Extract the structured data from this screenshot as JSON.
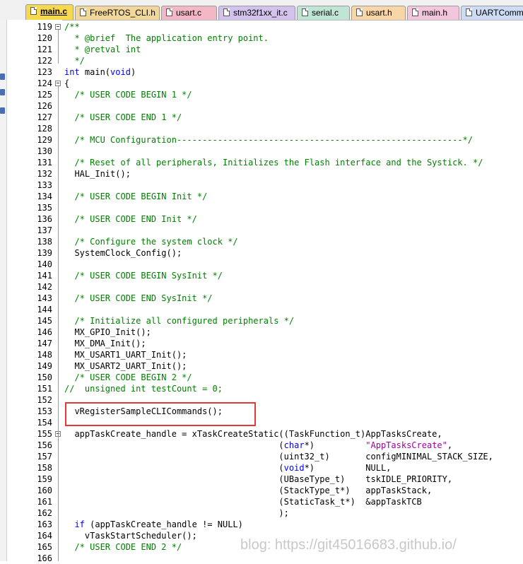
{
  "tabs": [
    {
      "label": "main.c",
      "active": true,
      "color": "#f7d94f"
    },
    {
      "label": "FreeRTOS_CLI.h",
      "active": false,
      "color": "#f2d79a"
    },
    {
      "label": "usart.c",
      "active": false,
      "color": "#f4b7c6"
    },
    {
      "label": "stm32f1xx_it.c",
      "active": false,
      "color": "#d3c2ec"
    },
    {
      "label": "serial.c",
      "active": false,
      "color": "#bfe6d5"
    },
    {
      "label": "usart.h",
      "active": false,
      "color": "#f8d6a8"
    },
    {
      "label": "main.h",
      "active": false,
      "color": "#f2c6dd"
    },
    {
      "label": "UARTComm",
      "active": false,
      "color": "#cddcf4"
    }
  ],
  "colors": {
    "comment": "#008000",
    "keyword": "#0000ff",
    "string": "#a000a0",
    "highlight_box": "#e53935"
  },
  "watermark": "blog: https://git45016683.github.io/",
  "lines": [
    {
      "n": "119",
      "fold": true,
      "parts": [
        [
          "cmt",
          "/**"
        ]
      ]
    },
    {
      "n": "120",
      "parts": [
        [
          "cmt",
          "  * @brief  The application entry point."
        ]
      ]
    },
    {
      "n": "121",
      "parts": [
        [
          "cmt",
          "  * @retval int"
        ]
      ]
    },
    {
      "n": "122",
      "parts": [
        [
          "cmt",
          "  */"
        ]
      ]
    },
    {
      "n": "123",
      "parts": [
        [
          "kw",
          "int"
        ],
        [
          "",
          " main("
        ],
        [
          "kw",
          "void"
        ],
        [
          "",
          ")"
        ]
      ]
    },
    {
      "n": "124",
      "fold": true,
      "parts": [
        [
          "",
          "{"
        ]
      ]
    },
    {
      "n": "125",
      "parts": [
        [
          "cmt",
          "  /* USER CODE BEGIN 1 */"
        ]
      ]
    },
    {
      "n": "126",
      "parts": []
    },
    {
      "n": "127",
      "parts": [
        [
          "cmt",
          "  /* USER CODE END 1 */"
        ]
      ]
    },
    {
      "n": "128",
      "parts": []
    },
    {
      "n": "129",
      "parts": [
        [
          "cmt",
          "  /* MCU Configuration--------------------------------------------------------*/"
        ]
      ]
    },
    {
      "n": "130",
      "parts": []
    },
    {
      "n": "131",
      "parts": [
        [
          "cmt",
          "  /* Reset of all peripherals, Initializes the Flash interface and the Systick. */"
        ]
      ]
    },
    {
      "n": "132",
      "parts": [
        [
          "",
          "  HAL_Init();"
        ]
      ]
    },
    {
      "n": "133",
      "parts": []
    },
    {
      "n": "134",
      "parts": [
        [
          "cmt",
          "  /* USER CODE BEGIN Init */"
        ]
      ]
    },
    {
      "n": "135",
      "parts": []
    },
    {
      "n": "136",
      "parts": [
        [
          "cmt",
          "  /* USER CODE END Init */"
        ]
      ]
    },
    {
      "n": "137",
      "parts": []
    },
    {
      "n": "138",
      "parts": [
        [
          "cmt",
          "  /* Configure the system clock */"
        ]
      ]
    },
    {
      "n": "139",
      "parts": [
        [
          "",
          "  SystemClock_Config();"
        ]
      ]
    },
    {
      "n": "140",
      "parts": []
    },
    {
      "n": "141",
      "parts": [
        [
          "cmt",
          "  /* USER CODE BEGIN SysInit */"
        ]
      ]
    },
    {
      "n": "142",
      "parts": []
    },
    {
      "n": "143",
      "parts": [
        [
          "cmt",
          "  /* USER CODE END SysInit */"
        ]
      ]
    },
    {
      "n": "144",
      "parts": []
    },
    {
      "n": "145",
      "parts": [
        [
          "cmt",
          "  /* Initialize all configured peripherals */"
        ]
      ]
    },
    {
      "n": "146",
      "parts": [
        [
          "",
          "  MX_GPIO_Init();"
        ]
      ]
    },
    {
      "n": "147",
      "parts": [
        [
          "",
          "  MX_DMA_Init();"
        ]
      ]
    },
    {
      "n": "148",
      "parts": [
        [
          "",
          "  MX_USART1_UART_Init();"
        ]
      ]
    },
    {
      "n": "149",
      "parts": [
        [
          "",
          "  MX_USART2_UART_Init();"
        ]
      ]
    },
    {
      "n": "150",
      "parts": [
        [
          "cmt",
          "  /* USER CODE BEGIN 2 */"
        ]
      ]
    },
    {
      "n": "151",
      "parts": [
        [
          "cmt",
          "//  unsigned int testCount = 0;"
        ]
      ]
    },
    {
      "n": "152",
      "parts": []
    },
    {
      "n": "153",
      "parts": [
        [
          "",
          "  vRegisterSampleCLICommands();"
        ]
      ]
    },
    {
      "n": "154",
      "parts": []
    },
    {
      "n": "155",
      "fold": true,
      "parts": [
        [
          "",
          "  appTaskCreate_handle = xTaskCreateStatic((TaskFunction_t)AppTasksCreate,"
        ]
      ]
    },
    {
      "n": "156",
      "parts": [
        [
          "",
          "                                          ("
        ],
        [
          "kw",
          "char"
        ],
        [
          "",
          "*)          "
        ],
        [
          "str",
          "\"AppTasksCreate\""
        ],
        [
          "",
          ","
        ]
      ]
    },
    {
      "n": "157",
      "parts": [
        [
          "",
          "                                          (uint32_t)       configMINIMAL_STACK_SIZE,"
        ]
      ]
    },
    {
      "n": "158",
      "parts": [
        [
          "",
          "                                          ("
        ],
        [
          "kw",
          "void"
        ],
        [
          "",
          "*)          NULL,"
        ]
      ]
    },
    {
      "n": "159",
      "parts": [
        [
          "",
          "                                          (UBaseType_t)    tskIDLE_PRIORITY,"
        ]
      ]
    },
    {
      "n": "160",
      "parts": [
        [
          "",
          "                                          (StackType_t*)   appTaskStack,"
        ]
      ]
    },
    {
      "n": "161",
      "parts": [
        [
          "",
          "                                          (StaticTask_t*)  &appTaskTCB"
        ]
      ]
    },
    {
      "n": "162",
      "parts": [
        [
          "",
          "                                          );"
        ]
      ]
    },
    {
      "n": "163",
      "parts": [
        [
          "",
          "  "
        ],
        [
          "kw",
          "if"
        ],
        [
          "",
          " (appTaskCreate_handle != NULL)"
        ]
      ]
    },
    {
      "n": "164",
      "parts": [
        [
          "",
          "    vTaskStartScheduler();"
        ]
      ]
    },
    {
      "n": "165",
      "parts": [
        [
          "cmt",
          "  /* USER CODE END 2 */"
        ]
      ]
    },
    {
      "n": "166",
      "parts": []
    }
  ]
}
